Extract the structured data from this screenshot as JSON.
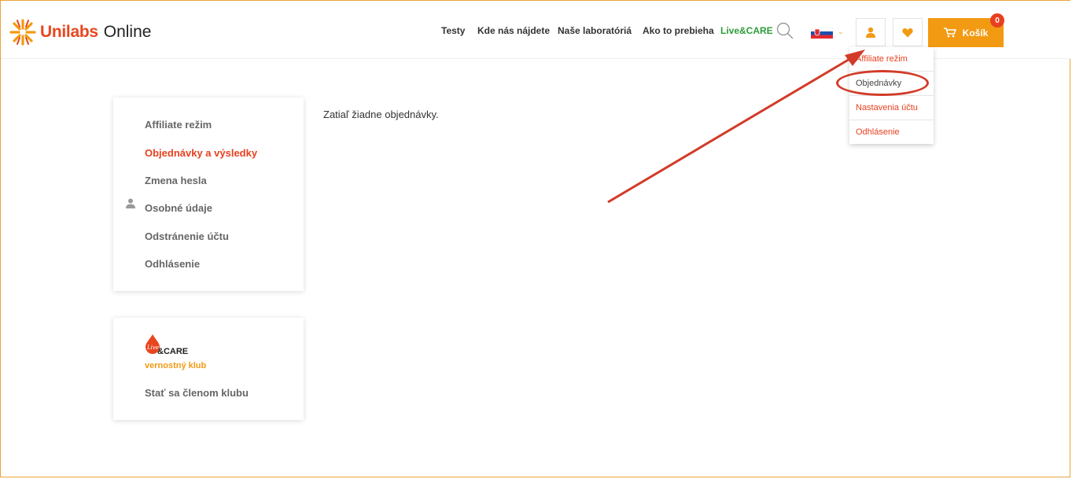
{
  "header": {
    "brand": "Unilabs",
    "brand_suffix": "Online",
    "nav": [
      "Testy",
      "Kde nás nájdete",
      "Naše laboratóriá",
      "Ako to prebieha",
      "Live&CARE"
    ],
    "cart_label": "Košík",
    "cart_count": "0",
    "icons": {
      "search": "search-icon",
      "flag": "slovak-flag-icon",
      "user": "user-icon",
      "favorites": "heart-icon",
      "cart": "cart-icon"
    }
  },
  "dropdown": {
    "items": [
      "Affiliate režim",
      "Objednávky",
      "Nastavenia účtu",
      "Odhlásenie"
    ],
    "active_index": 1
  },
  "sidebar": {
    "items": [
      "Affiliate režim",
      "Objednávky a výsledky",
      "Zmena hesla",
      "Osobné údaje",
      "Odstránenie účtu",
      "Odhlásenie"
    ],
    "active_index": 1
  },
  "club": {
    "logo_text": "&CARE",
    "logo_script": "Live",
    "subtitle": "vernostný klub",
    "cta": "Stať sa členom klubu"
  },
  "main": {
    "empty_message": "Zatiaľ žiadne objednávky."
  },
  "colors": {
    "accent": "#e8401f",
    "orange": "#f29a12",
    "annotation": "#d23b28"
  }
}
